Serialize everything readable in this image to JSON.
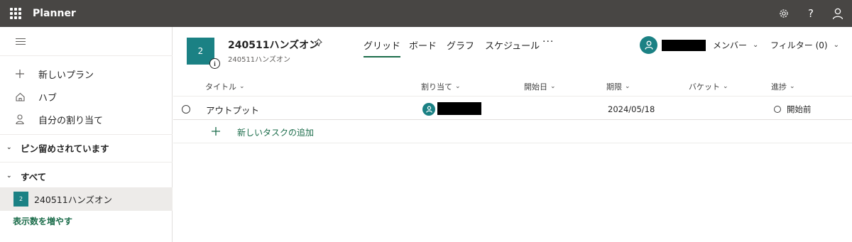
{
  "app": {
    "title": "Planner"
  },
  "topbar": {
    "settings_icon": "gear-icon",
    "help_label": "?",
    "account_icon": "person-icon"
  },
  "sidebar": {
    "nav": [
      {
        "label": "新しいプラン",
        "icon": "plus-icon"
      },
      {
        "label": "ハブ",
        "icon": "home-icon"
      },
      {
        "label": "自分の割り当て",
        "icon": "person-icon"
      }
    ],
    "pinned_label": "ピン留めされています",
    "all_label": "すべて",
    "plan": {
      "tile": "2",
      "name": "240511ハンズオン"
    },
    "more_label": "表示数を増やす"
  },
  "plan_header": {
    "tile": "2",
    "info": "i",
    "name": "240511ハンズオン",
    "subtitle": "240511ハンズオン",
    "tabs": [
      "グリッド",
      "ボード",
      "グラフ",
      "スケジュール"
    ],
    "active_tab": "グリッド",
    "more": "···",
    "members_label": "メンバー",
    "filter_label": "フィルター (0)"
  },
  "grid": {
    "columns": [
      "タイトル",
      "割り当て",
      "開始日",
      "期限",
      "バケット",
      "進捗"
    ],
    "rows": [
      {
        "title": "アウトプット",
        "start": "",
        "due": "2024/05/18",
        "bucket": "",
        "progress": "開始前"
      }
    ],
    "add_task_label": "新しいタスクの追加"
  },
  "colors": {
    "topbar": "#484644",
    "accent": "#1b8184",
    "link": "#1b6c4a"
  }
}
